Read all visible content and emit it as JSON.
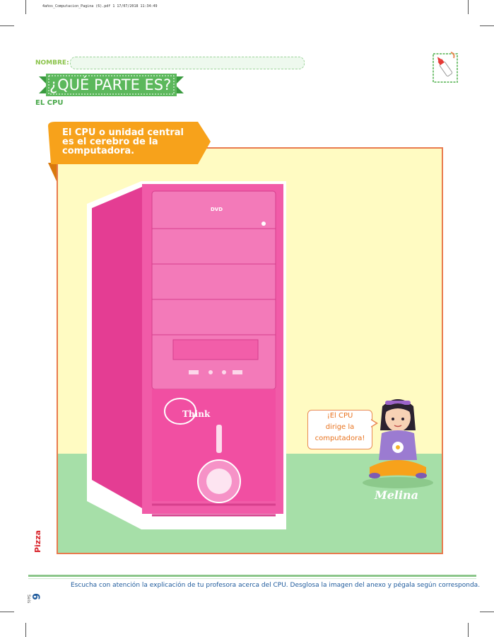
{
  "header": {
    "file_info": "4años_Computacion_Pagina (6).pdf   1   17/07/2018   11:34:49"
  },
  "form": {
    "name_label": "NOMBRE:"
  },
  "title": {
    "heading": "¿QUÉ PARTE ES?",
    "subheading": "EL CPU"
  },
  "intro": {
    "line1": "El CPU o unidad central",
    "line2": "es el cerebro de la",
    "line3": "computadora."
  },
  "cpu_labels": {
    "drive": "DVD",
    "brand": "Think"
  },
  "speech": {
    "line1": "¡El CPU",
    "line2": "dirige la",
    "line3": "computadora!"
  },
  "character": {
    "name": "Melina"
  },
  "footer": {
    "instructions": "Escucha con atención la explicación de tu profesora acerca del CPU. Desglosa la imagen del anexo y pégala según corresponda.",
    "page_number": "6",
    "page_label": "Seis",
    "logo": "Pizza"
  },
  "colors": {
    "green": "#8bc34a",
    "orange": "#f7a21b",
    "pink": "#ee4c9e",
    "frame": "#e87a4e",
    "blue": "#1e5a9c"
  },
  "icons": [
    "glue-icon"
  ]
}
